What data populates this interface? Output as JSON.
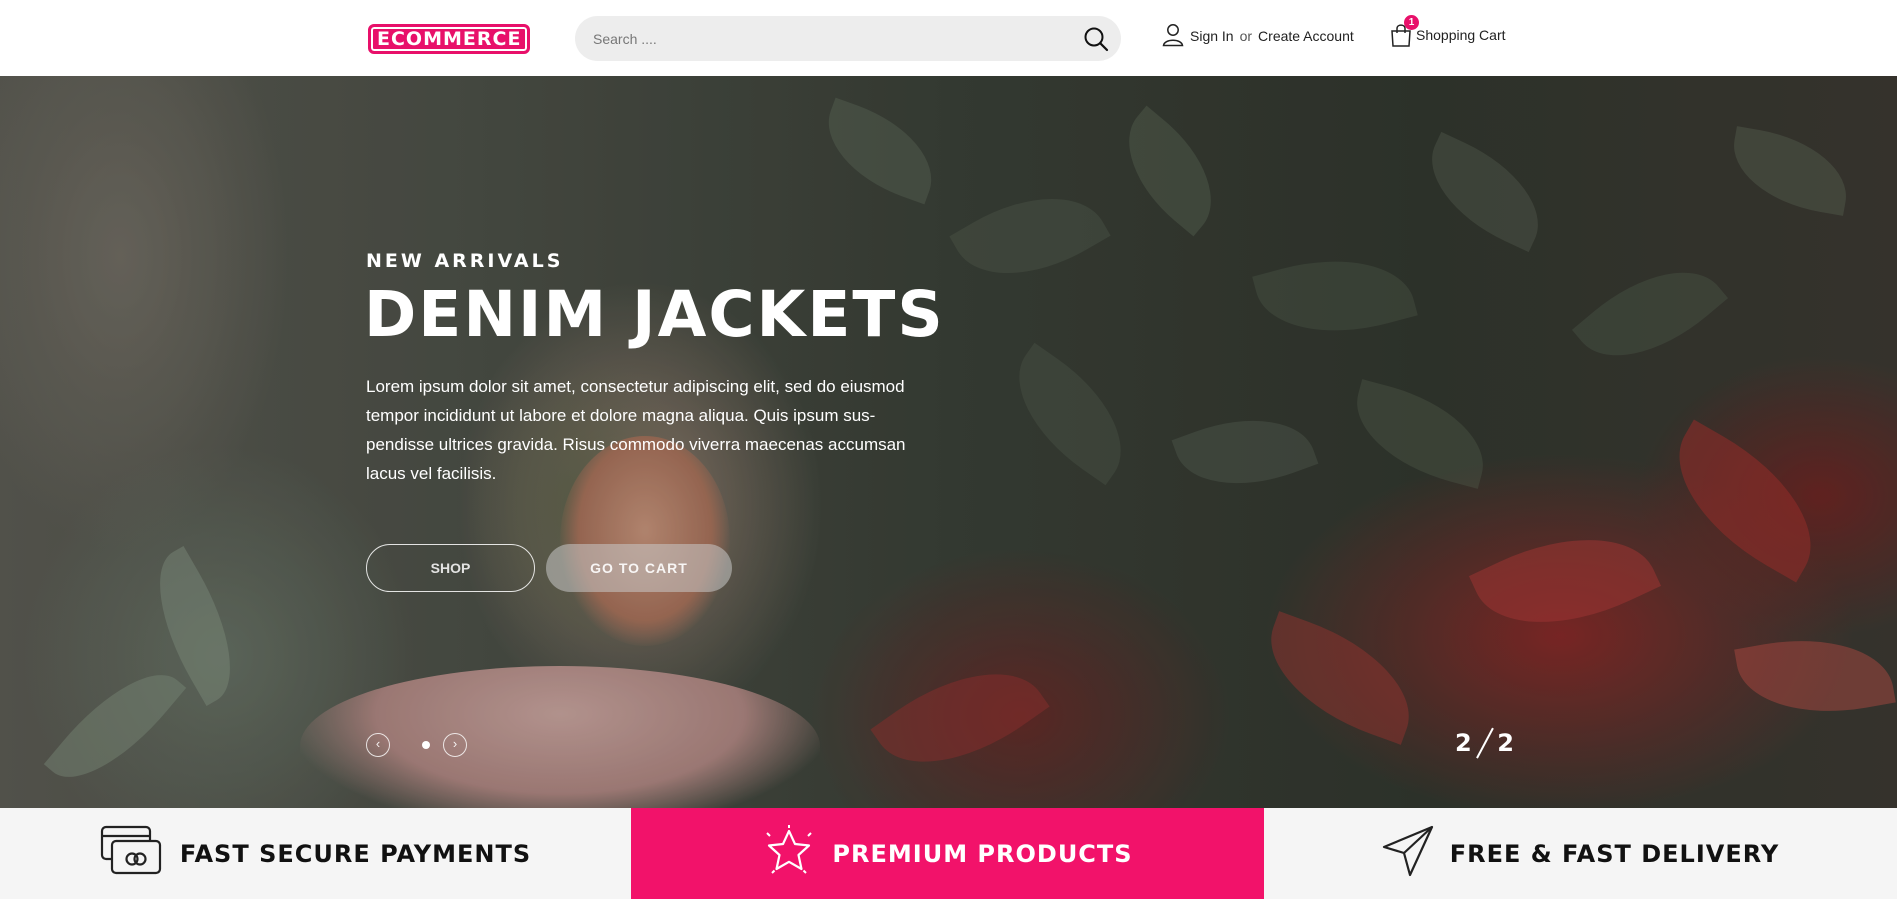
{
  "header": {
    "logo_text": "ECOMMERCE",
    "search_placeholder": "Search ....",
    "sign_in": "Sign In",
    "or": "or",
    "create_account": "Create Account",
    "cart_label": "Shopping Cart",
    "cart_count": "1"
  },
  "hero": {
    "eyebrow": "NEW ARRIVALS",
    "title": "DENIM JACKETS",
    "description": "Lorem ipsum dolor sit amet, consectetur adipiscing elit, sed do eiusmod tempor incididunt ut labore et dolore magna aliqua. Quis ipsum sus-pendisse ultrices gravida. Risus commodo viverra maecenas accumsan lacus vel facilisis.",
    "shop_button": "SHOP",
    "cart_button": "GO TO CART",
    "slide_current": "2",
    "slide_total": "2"
  },
  "features": [
    {
      "label": "FAST SECURE PAYMENTS",
      "icon": "credit-card-icon"
    },
    {
      "label": "PREMIUM PRODUCTS",
      "icon": "star-icon"
    },
    {
      "label": "FREE & FAST DELIVERY",
      "icon": "paper-plane-icon"
    }
  ],
  "colors": {
    "accent": "#f2126a",
    "feature_bg": "#f5f5f5",
    "search_bg": "#ededed"
  }
}
